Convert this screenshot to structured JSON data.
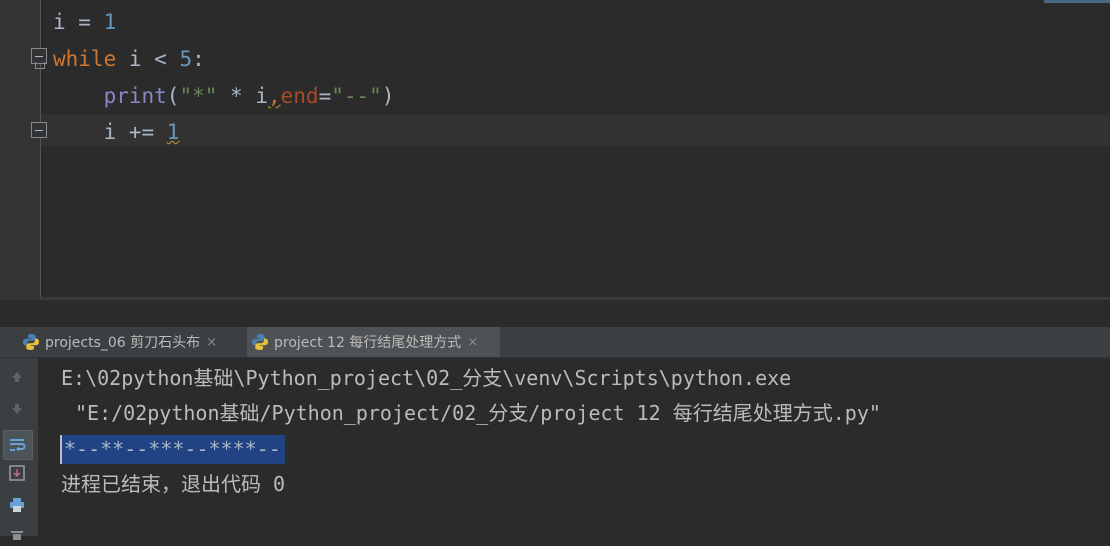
{
  "editor": {
    "lines": [
      {
        "p1": "i ",
        "op": "= ",
        "num": "1"
      },
      {
        "kw": "while",
        "p1": " i < ",
        "num": "5",
        "p2": ":"
      },
      {
        "indent": "    ",
        "builtin": "print",
        "p1": "(",
        "str1": "\"*\"",
        "p2": " * i",
        "comma": ",",
        "param": "end",
        "eq": "=",
        "str2": "\"--\"",
        "p3": ")"
      },
      {
        "indent": "    ",
        "p1": "i += ",
        "num": "1"
      }
    ]
  },
  "run_tabs": [
    {
      "label": "projects_06 剪刀石头布",
      "close": "×"
    },
    {
      "label": "project 12 每行结尾处理方式",
      "close": "×"
    }
  ],
  "console": {
    "cmd_line1": "E:\\02python基础\\Python_project\\02_分支\\venv\\Scripts\\python.exe",
    "cmd_line2": "\"E:/02python基础/Python_project/02_分支/project 12 每行结尾处理方式.py\"",
    "program_output": "*--**--***--****--",
    "exit_message": "进程已结束，退出代码 0"
  },
  "toolbar": {
    "icons": [
      "arrow-up-icon",
      "arrow-down-icon",
      "soft-wrap-icon",
      "scroll-to-end-icon",
      "print-icon",
      "trash-icon"
    ]
  },
  "colors": {
    "keyword": "#cc7832",
    "number": "#6897bb",
    "string": "#6a8759",
    "builtin": "#8888c6",
    "selection": "#214283"
  }
}
